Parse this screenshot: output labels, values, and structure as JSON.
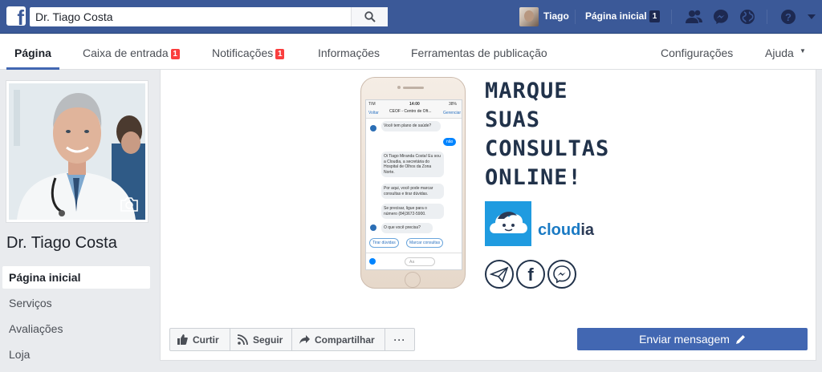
{
  "topbar": {
    "search_value": "Dr. Tiago Costa",
    "user_name": "Tiago",
    "home_label": "Página inicial",
    "home_count": "1",
    "logo_letter": "f"
  },
  "page_nav": {
    "items": [
      "Página",
      "Caixa de entrada",
      "Notificações",
      "Informações",
      "Ferramentas de publicação"
    ],
    "inbox_badge": "1",
    "notifications_badge": "1",
    "settings": "Configurações",
    "help": "Ajuda"
  },
  "left": {
    "page_name": "Dr. Tiago Costa",
    "nav": [
      "Página inicial",
      "Serviços",
      "Avaliações",
      "Loja"
    ]
  },
  "cover": {
    "headline": [
      "MARQUE",
      "SUAS",
      "CONSULTAS",
      "ONLINE!"
    ],
    "brand_prefix": "cloud",
    "brand_suffix": "ia",
    "phone": {
      "status_left": "TIM",
      "status_time": "14:00",
      "status_right": "38%",
      "back": "Voltar",
      "contact": "CEOF - Centro de Oft...",
      "manage": "Gerenciar",
      "msg_1": "Você tem plano de saúde?",
      "reply_1": "não",
      "msg_2": "Oi Tiago Miranda Costa! Eu sou a Cloudia, a secretária do Hospital de Olhos da Zona Norte.",
      "msg_3": "Por aqui, você pode marcar consultas e tirar dúvidas.",
      "msg_4": "Se precisar, ligue para o número (84)3672-5900.",
      "msg_5": "O que você precisa?",
      "chip_1": "Tirar dúvidas",
      "chip_2": "Marcar consultas",
      "input_hint": "Aa"
    },
    "colors": {
      "text": "#21324a",
      "brand": "#1a7ac4",
      "tile": "#1f9be0"
    }
  },
  "actions": {
    "like": "Curtir",
    "follow": "Seguir",
    "share": "Compartilhar",
    "more": "···",
    "send": "Enviar mensagem"
  },
  "colors": {
    "facebook_blue": "#3b5998",
    "button_blue": "#4267b2",
    "badge_red": "#fa3e3e"
  }
}
